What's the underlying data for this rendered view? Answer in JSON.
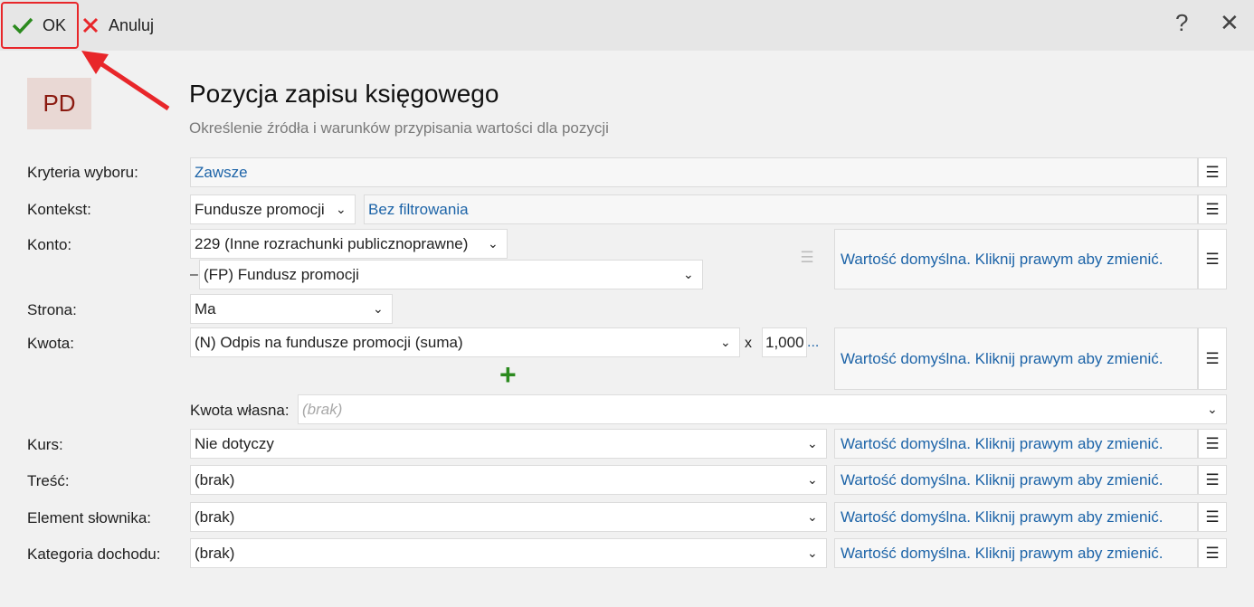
{
  "toolbar": {
    "ok_label": "OK",
    "cancel_label": "Anuluj",
    "help_glyph": "?",
    "close_glyph": "✕"
  },
  "header": {
    "badge": "PD",
    "title": "Pozycja zapisu księgowego",
    "subtitle": "Określenie źródła i warunków przypisania wartości dla pozycji"
  },
  "form": {
    "kryteria": {
      "label": "Kryteria wyboru:",
      "value": "Zawsze"
    },
    "kontekst": {
      "label": "Kontekst:",
      "select": "Fundusze promocji",
      "filter": "Bez filtrowania"
    },
    "konto": {
      "label": "Konto:",
      "select": "229 (Inne rozrachunki publicznoprawne)",
      "dash": "–",
      "subselect": "(FP) Fundusz promocji",
      "value_box": "Wartość domyślna. Kliknij prawym aby zmienić."
    },
    "strona": {
      "label": "Strona:",
      "select": "Ma"
    },
    "kwota": {
      "label": "Kwota:",
      "select": "(N) Odpis na fundusze promocji (suma)",
      "multiplier_sign": "x",
      "multiplier": "1,000",
      "ellipsis": "...",
      "value_box": "Wartość domyślna. Kliknij prawym aby zmienić."
    },
    "kwota_wlasna": {
      "label": "Kwota własna:",
      "placeholder": "(brak)"
    },
    "kurs": {
      "label": "Kurs:",
      "select": "Nie dotyczy",
      "value_box": "Wartość domyślna. Kliknij prawym aby zmienić."
    },
    "tresc": {
      "label": "Treść:",
      "select": "(brak)",
      "value_box": "Wartość domyślna. Kliknij prawym aby zmienić."
    },
    "element": {
      "label": "Element słownika:",
      "select": "(brak)",
      "value_box": "Wartość domyślna. Kliknij prawym aby zmienić."
    },
    "kategoria": {
      "label": "Kategoria dochodu:",
      "select": "(brak)",
      "value_box": "Wartość domyślna. Kliknij prawym aby zmienić."
    }
  },
  "colors": {
    "link": "#1d64a8",
    "ok_check": "#2b8a1e",
    "cancel_x": "#e8262a",
    "highlight": "#e8262a",
    "badge_bg": "#e9d8d4",
    "badge_text": "#8b1a10"
  },
  "icons": {
    "ok": "check-icon",
    "cancel": "x-icon",
    "help": "question-icon",
    "close": "close-icon",
    "menu": "hamburger-icon",
    "dropdown": "chevron-down-icon",
    "add": "plus-icon"
  }
}
